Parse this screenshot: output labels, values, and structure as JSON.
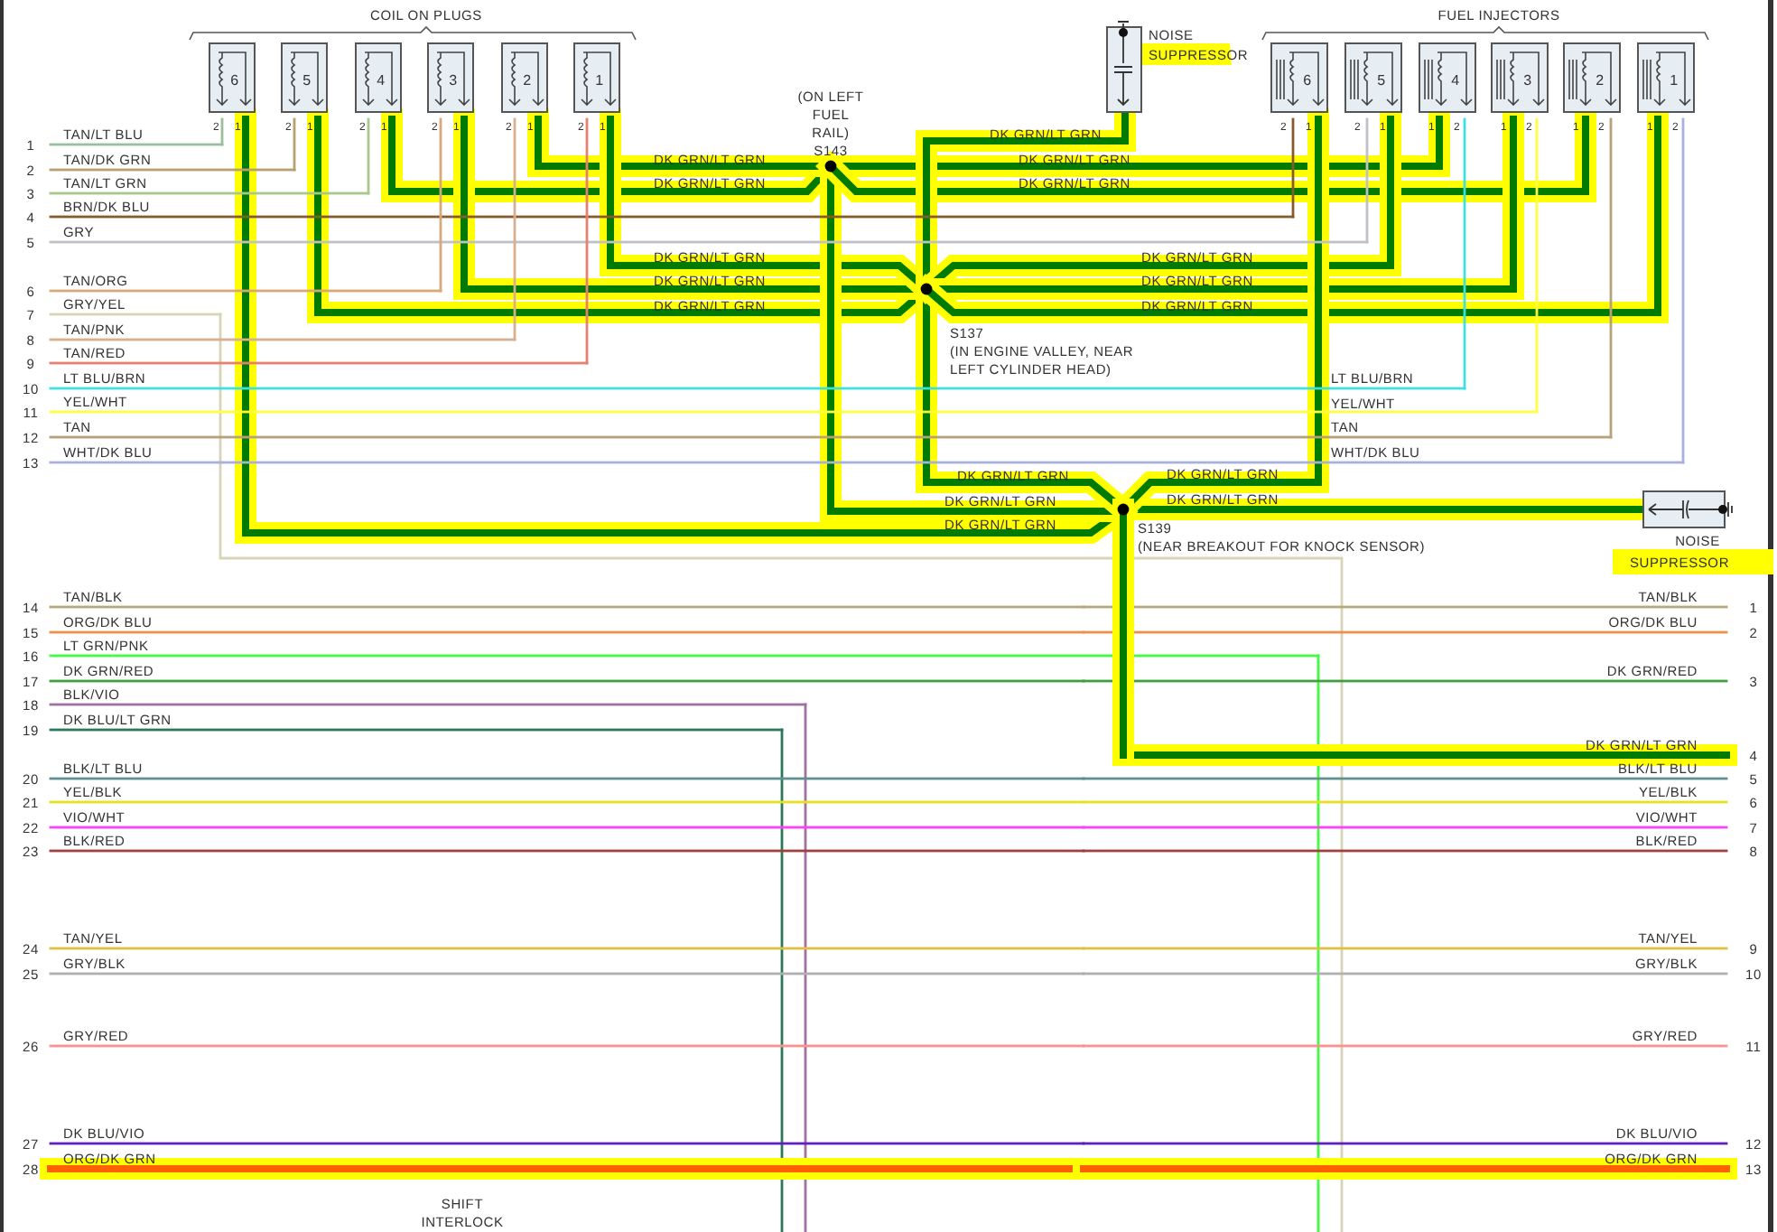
{
  "coil_on_plugs": {
    "title": "COIL ON PLUGS",
    "coils": [
      {
        "number": "6",
        "pin_labels": [
          "2",
          "1"
        ]
      },
      {
        "number": "5",
        "pin_labels": [
          "2",
          "1"
        ]
      },
      {
        "number": "4",
        "pin_labels": [
          "2",
          "1"
        ]
      },
      {
        "number": "3",
        "pin_labels": [
          "2",
          "1"
        ]
      },
      {
        "number": "2",
        "pin_labels": [
          "2",
          "1"
        ]
      },
      {
        "number": "1",
        "pin_labels": [
          "2",
          "1"
        ]
      }
    ]
  },
  "fuel_injectors": {
    "title": "FUEL INJECTORS",
    "injectors": [
      {
        "number": "6",
        "pin_labels": [
          "2",
          "1"
        ]
      },
      {
        "number": "5",
        "pin_labels": [
          "2",
          "1"
        ]
      },
      {
        "number": "4",
        "pin_labels": [
          "1",
          "2"
        ]
      },
      {
        "number": "3",
        "pin_labels": [
          "1",
          "2"
        ]
      },
      {
        "number": "2",
        "pin_labels": [
          "1",
          "2"
        ]
      },
      {
        "number": "1",
        "pin_labels": [
          "1",
          "2"
        ]
      }
    ]
  },
  "noise_suppressors": [
    {
      "label_lines": [
        "NOISE",
        "SUPPRESSOR"
      ],
      "highlighted": true
    },
    {
      "label_lines": [
        "NOISE",
        "SUPPRESSOR"
      ],
      "highlighted": true
    }
  ],
  "splices": [
    {
      "name": "S143",
      "location_lines": [
        "(ON LEFT",
        "FUEL",
        "RAIL)"
      ]
    },
    {
      "name": "S137",
      "location_lines": [
        "(IN ENGINE VALLEY, NEAR",
        "LEFT CYLINDER HEAD)"
      ]
    },
    {
      "name": "S139",
      "location_lines": [
        "(NEAR BREAKOUT FOR KNOCK SENSOR)"
      ]
    }
  ],
  "ground_network": {
    "highlighted": true,
    "color": "#007a00",
    "labels": [
      "DK GRN/LT GRN",
      "DK GRN/LT GRN",
      "DK GRN/LT GRN",
      "DK GRN/LT GRN",
      "DK GRN/LT GRN",
      "DK GRN/LT GRN",
      "DK GRN/LT GRN",
      "DK GRN/LT GRN",
      "DK GRN/LT GRN",
      "DK GRN/LT GRN",
      "DK GRN/LT GRN",
      "DK GRN/LT GRN",
      "DK GRN/LT GRN",
      "DK GRN/LT GRN",
      "DK GRN/LT GRN",
      "DK GRN/LT GRN"
    ]
  },
  "injector_wire_labels": [
    "LT BLU/BRN",
    "YEL/WHT",
    "TAN",
    "WHT/DK BLU"
  ],
  "left_connector": [
    {
      "pin": "1",
      "wire": "TAN/LT BLU",
      "color": "#9bbf9b",
      "highlighted": false
    },
    {
      "pin": "2",
      "wire": "TAN/DK GRN",
      "color": "#b8a070",
      "highlighted": false
    },
    {
      "pin": "3",
      "wire": "TAN/LT GRN",
      "color": "#a8c890",
      "highlighted": false
    },
    {
      "pin": "4",
      "wire": "BRN/DK BLU",
      "color": "#8b5a2b",
      "highlighted": false
    },
    {
      "pin": "5",
      "wire": "GRY",
      "color": "#c0c0c8",
      "highlighted": false
    },
    {
      "pin": "6",
      "wire": "TAN/ORG",
      "color": "#d8a878",
      "highlighted": false
    },
    {
      "pin": "7",
      "wire": "GRY/YEL",
      "color": "#d8d4b8",
      "highlighted": false
    },
    {
      "pin": "8",
      "wire": "TAN/PNK",
      "color": "#d8b090",
      "highlighted": false
    },
    {
      "pin": "9",
      "wire": "TAN/RED",
      "color": "#e88070",
      "highlighted": false
    },
    {
      "pin": "10",
      "wire": "LT BLU/BRN",
      "color": "#40e0e0",
      "highlighted": false
    },
    {
      "pin": "11",
      "wire": "YEL/WHT",
      "color": "#ffff40",
      "highlighted": false
    },
    {
      "pin": "12",
      "wire": "TAN",
      "color": "#b8a078",
      "highlighted": false
    },
    {
      "pin": "13",
      "wire": "WHT/DK BLU",
      "color": "#a8b0e0",
      "highlighted": false
    },
    {
      "pin": "14",
      "wire": "TAN/BLK",
      "color": "#b8a878",
      "highlighted": false
    },
    {
      "pin": "15",
      "wire": "ORG/DK BLU",
      "color": "#f09050",
      "highlighted": false
    },
    {
      "pin": "16",
      "wire": "LT GRN/PNK",
      "color": "#40ff40",
      "highlighted": false
    },
    {
      "pin": "17",
      "wire": "DK GRN/RED",
      "color": "#40a040",
      "highlighted": false
    },
    {
      "pin": "18",
      "wire": "BLK/VIO",
      "color": "#a070a0",
      "highlighted": false
    },
    {
      "pin": "19",
      "wire": "DK BLU/LT GRN",
      "color": "#2a7a5a",
      "highlighted": false
    },
    {
      "pin": "20",
      "wire": "BLK/LT BLU",
      "color": "#609090",
      "highlighted": false
    },
    {
      "pin": "21",
      "wire": "YEL/BLK",
      "color": "#e8e020",
      "highlighted": false
    },
    {
      "pin": "22",
      "wire": "VIO/WHT",
      "color": "#ff40ff",
      "highlighted": false
    },
    {
      "pin": "23",
      "wire": "BLK/RED",
      "color": "#a04040",
      "highlighted": false
    },
    {
      "pin": "24",
      "wire": "TAN/YEL",
      "color": "#e0c040",
      "highlighted": false
    },
    {
      "pin": "25",
      "wire": "GRY/BLK",
      "color": "#b0b0b0",
      "highlighted": false
    },
    {
      "pin": "26",
      "wire": "GRY/RED",
      "color": "#ff9090",
      "highlighted": false
    },
    {
      "pin": "27",
      "wire": "DK BLU/VIO",
      "color": "#6020c0",
      "highlighted": false
    },
    {
      "pin": "28",
      "wire": "ORG/DK GRN",
      "color": "#ff6000",
      "highlighted": true
    }
  ],
  "right_connector": [
    {
      "pin": "1",
      "wire": "TAN/BLK",
      "color": "#b8a878",
      "highlighted": false
    },
    {
      "pin": "2",
      "wire": "ORG/DK BLU",
      "color": "#f09050",
      "highlighted": false
    },
    {
      "pin": "3",
      "wire": "DK GRN/RED",
      "color": "#40a040",
      "highlighted": false
    },
    {
      "pin": "4",
      "wire": "DK GRN/LT GRN",
      "color": "#007a00",
      "highlighted": true
    },
    {
      "pin": "5",
      "wire": "BLK/LT BLU",
      "color": "#609090",
      "highlighted": false
    },
    {
      "pin": "6",
      "wire": "YEL/BLK",
      "color": "#e8e020",
      "highlighted": false
    },
    {
      "pin": "7",
      "wire": "VIO/WHT",
      "color": "#ff40ff",
      "highlighted": false
    },
    {
      "pin": "8",
      "wire": "BLK/RED",
      "color": "#a04040",
      "highlighted": false
    },
    {
      "pin": "9",
      "wire": "TAN/YEL",
      "color": "#e0c040",
      "highlighted": false
    },
    {
      "pin": "10",
      "wire": "GRY/BLK",
      "color": "#b0b0b0",
      "highlighted": false
    },
    {
      "pin": "11",
      "wire": "GRY/RED",
      "color": "#ff9090",
      "highlighted": false
    },
    {
      "pin": "12",
      "wire": "DK BLU/VIO",
      "color": "#6020c0",
      "highlighted": false
    },
    {
      "pin": "13",
      "wire": "ORG/DK GRN",
      "color": "#ff6000",
      "highlighted": true
    }
  ],
  "shift_interlock": {
    "label_lines": [
      "SHIFT",
      "INTERLOCK"
    ]
  }
}
